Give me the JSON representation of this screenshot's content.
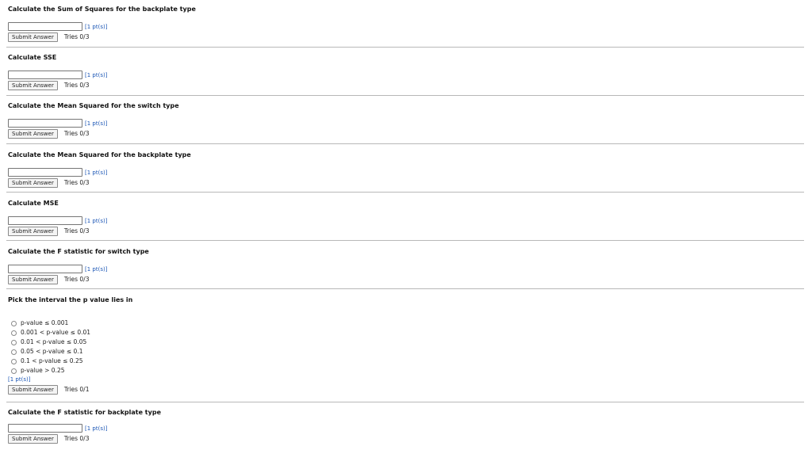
{
  "questions": [
    {
      "title": "Calculate the Sum of Squares for the backplate type",
      "points": "[1 pt(s)]",
      "submit_label": "Submit Answer",
      "tries": "Tries 0/3",
      "value": ""
    },
    {
      "title": "Calculate SSE",
      "points": "[1 pt(s)]",
      "submit_label": "Submit Answer",
      "tries": "Tries 0/3",
      "value": ""
    },
    {
      "title": "Calculate the Mean Squared for the switch type",
      "points": "[1 pt(s)]",
      "submit_label": "Submit Answer",
      "tries": "Tries 0/3",
      "value": ""
    },
    {
      "title": "Calculate the Mean Squared for the backplate type",
      "points": "[1 pt(s)]",
      "submit_label": "Submit Answer",
      "tries": "Tries 0/3",
      "value": ""
    },
    {
      "title": "Calculate MSE",
      "points": "[1 pt(s)]",
      "submit_label": "Submit Answer",
      "tries": "Tries 0/3",
      "value": ""
    },
    {
      "title": "Calculate the F statistic for switch type",
      "points": "[1 pt(s)]",
      "submit_label": "Submit Answer",
      "tries": "Tries 0/3",
      "value": ""
    }
  ],
  "pvalue_question": {
    "title": "Pick the interval the p value lies in",
    "options": [
      "p-value ≤ 0.001",
      "0.001 < p-value ≤ 0.01",
      "0.01 < p-value ≤ 0.05",
      "0.05 < p-value ≤ 0.1",
      "0.1 < p-value ≤ 0.25",
      "p-value > 0.25"
    ],
    "points": "[1 pt(s)]",
    "submit_label": "Submit Answer",
    "tries": "Tries 0/1"
  },
  "last_question": {
    "title": "Calculate the F statistic for backplate type",
    "points": "[1 pt(s)]",
    "submit_label": "Submit Answer",
    "tries": "Tries 0/3",
    "value": ""
  }
}
